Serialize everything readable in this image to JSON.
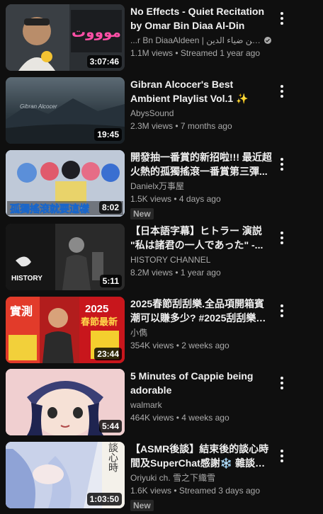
{
  "videos": [
    {
      "title": "No Effects - Quiet Recitation by Omar Bin Diaa Al-Din",
      "channel": "...r Bn DiaaAldeen | عمر بن ضياء الدين",
      "verified": true,
      "views": "1.1M views",
      "age": "Streamed 1 year ago",
      "duration": "3:07:46",
      "badge": ""
    },
    {
      "title": "Gibran Alcocer's Best Ambient Playlist Vol.1 ✨",
      "channel": "AbysSound",
      "verified": false,
      "views": "2.3M views",
      "age": "7 months ago",
      "duration": "19:45",
      "badge": ""
    },
    {
      "title": "開發抽一番賞的新招啦!!! 最近超火熱的孤獨搖滾一番賞第三彈...",
      "channel": "Danielx万事屋",
      "verified": false,
      "views": "1.5K views",
      "age": "4 days ago",
      "duration": "8:02",
      "badge": "New"
    },
    {
      "title": "【日本語字幕】ヒトラー 演説 \"私は諸君の一人であった\" -...",
      "channel": "HISTORY CHANNEL",
      "verified": false,
      "views": "8.2M views",
      "age": "1 year ago",
      "duration": "5:11",
      "badge": ""
    },
    {
      "title": "2025春節刮刮樂.全品項開箱賓潮可以賺多少? #2025刮刮樂蛇...",
      "channel": "小儁",
      "verified": false,
      "views": "354K views",
      "age": "2 weeks ago",
      "duration": "23:44",
      "badge": ""
    },
    {
      "title": "5 Minutes of Cappie being adorable",
      "channel": "walmark",
      "verified": false,
      "views": "464K views",
      "age": "4 weeks ago",
      "duration": "5:44",
      "badge": ""
    },
    {
      "title": "【ASMR後談】結束後的談心時間及SuperChat感謝❄️ 雜談／...",
      "channel": "Oriyuki ch. 雪之下織雪",
      "verified": false,
      "views": "1.6K views",
      "age": "Streamed 3 days ago",
      "duration": "1:03:50",
      "badge": "New"
    }
  ],
  "thumb_text": {
    "v0_overlay": "موووت",
    "v2_caption": "孤獨搖滾就要這樣",
    "v3_logo": "HISTORY",
    "v4_left": "實測",
    "v4_year": "2025",
    "v4_banner": "春節最新",
    "v6_side": "談心時"
  },
  "icons": {
    "menu": "more-vert-icon",
    "verified": "verified-check-icon"
  },
  "separator": "•"
}
